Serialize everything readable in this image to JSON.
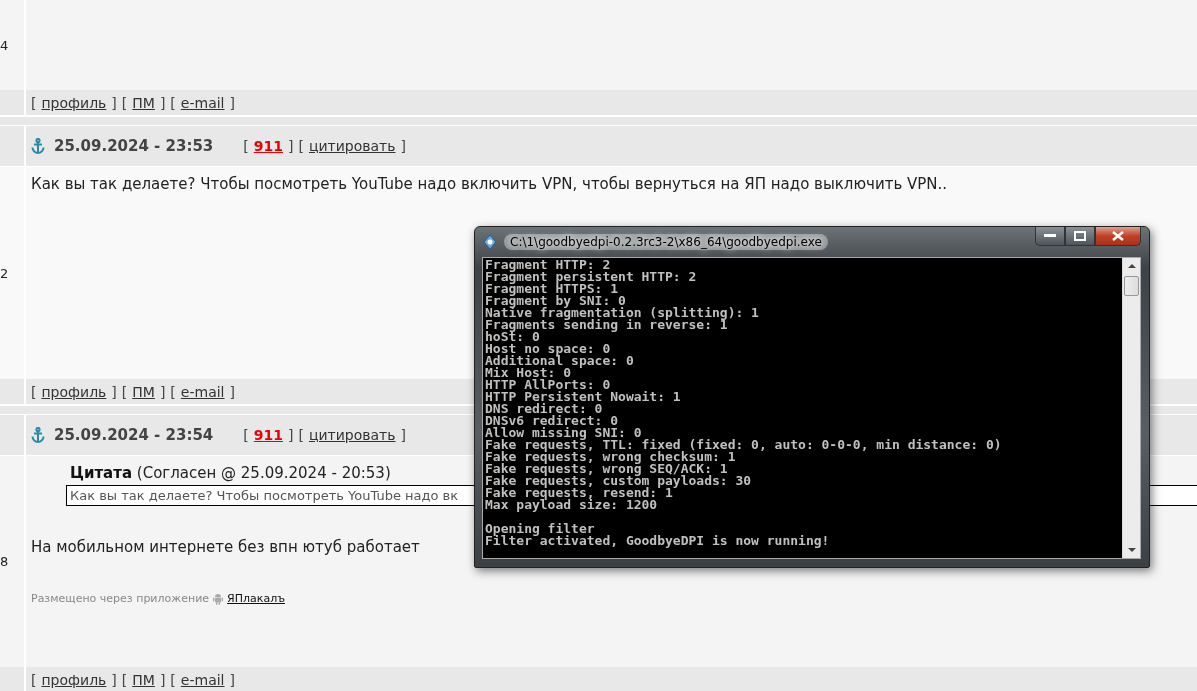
{
  "link_brackets": {
    "open": "[",
    "close": "]"
  },
  "top_post": {
    "side_text": "4",
    "links": [
      "профиль",
      "ПМ",
      "e-mail"
    ]
  },
  "posts": [
    {
      "side_text": "2",
      "date": "25.09.2024 - 23:53",
      "rating": "911",
      "quote_link": "цитировать",
      "text": "Как вы так делаете? Чтобы посмотреть YouTube надо включить VPN, чтобы вернуться на ЯП надо выключить VPN..",
      "links": [
        "профиль",
        "ПМ",
        "e-mail"
      ]
    },
    {
      "side_text": "8",
      "date": "25.09.2024 - 23:54",
      "rating": "911",
      "quote_link": "цитировать",
      "quote": {
        "label": "Цитата",
        "meta": "(Согласен @ 25.09.2024 - 20:53)",
        "text": "Как вы так делаете? Чтобы посмотреть YouTube надо вк"
      },
      "text": "На мобильном интернете без впн ютуб работает",
      "via": {
        "label": "Размещено через приложение",
        "app": "ЯПлакалъ"
      },
      "links": [
        "профиль",
        "ПМ",
        "e-mail"
      ]
    }
  ],
  "console_window": {
    "title": "C:\\1\\goodbyedpi-0.2.3rc3-2\\x86_64\\goodbyedpi.exe",
    "blocks": [
      {
        "lines": [
          "Fragment HTTP: 2",
          "Fragment persistent HTTP: 2",
          "Fragment HTTPS: 1",
          "Fragment by SNI: 0",
          "Native fragmentation (splitting): 1",
          "Fragments sending in reverse: 1",
          "hoSt: 0",
          "Host no space: 0",
          "Additional space: 0",
          "Mix Host: 0",
          "HTTP AllPorts: 0",
          "HTTP Persistent Nowait: 1",
          "DNS redirect: 0",
          "DNSv6 redirect: 0",
          "Allow missing SNI: 0",
          "Fake requests, TTL: fixed (fixed: 0, auto: 0-0-0, min distance: 0)",
          "Fake requests, wrong checksum: 1",
          "Fake requests, wrong SEQ/ACK: 1",
          "Fake requests, custom payloads: 30",
          "Fake requests, resend: 1",
          "Max payload size: 1200"
        ]
      },
      {
        "lines": [
          "Opening filter",
          "Filter activated, GoodbyeDPI is now running!"
        ]
      }
    ]
  }
}
